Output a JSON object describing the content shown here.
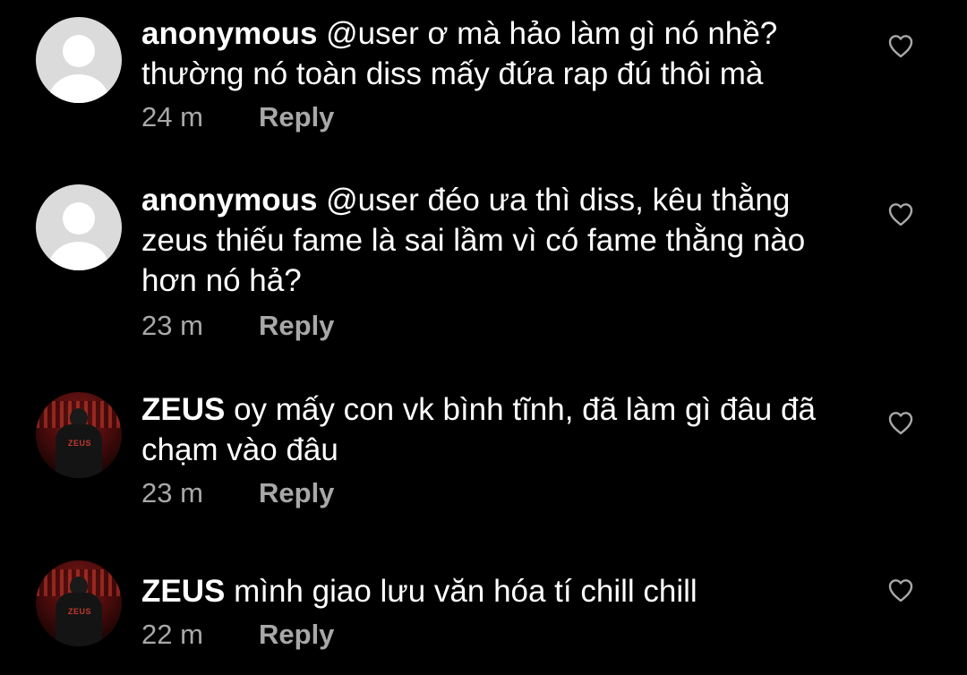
{
  "comments": [
    {
      "username": "anonymous",
      "mention": "@user",
      "text": " ơ mà hảo làm gì nó nhề? thường nó toàn diss mấy đứa rap đú thôi mà",
      "time": "24 m",
      "reply_label": "Reply",
      "avatar_icon": "default-avatar-icon"
    },
    {
      "username": "anonymous",
      "mention": "@user",
      "text": " đéo ưa thì diss, kêu thằng zeus thiếu fame là sai lầm vì có fame thằng nào hơn nó hả?",
      "time": "23 m",
      "reply_label": "Reply",
      "avatar_icon": "default-avatar-icon"
    },
    {
      "username": "ZEUS",
      "mention": "",
      "text": " oy mấy con vk bình tĩnh, đã làm gì đâu đã chạm vào đâu",
      "time": "23 m",
      "reply_label": "Reply",
      "avatar_icon": "profile-photo-avatar",
      "jersey_text": "ZEUS"
    },
    {
      "username": "ZEUS",
      "mention": "",
      "text": " mình giao lưu văn hóa tí chill chill",
      "time": "22 m",
      "reply_label": "Reply",
      "avatar_icon": "profile-photo-avatar",
      "jersey_text": "ZEUS"
    }
  ],
  "icons": {
    "like": "heart-outline-icon"
  },
  "colors": {
    "background": "#000000",
    "primary_text": "#ffffff",
    "secondary_text": "#a8a8a8",
    "default_avatar_bg": "#dbdbdb"
  }
}
